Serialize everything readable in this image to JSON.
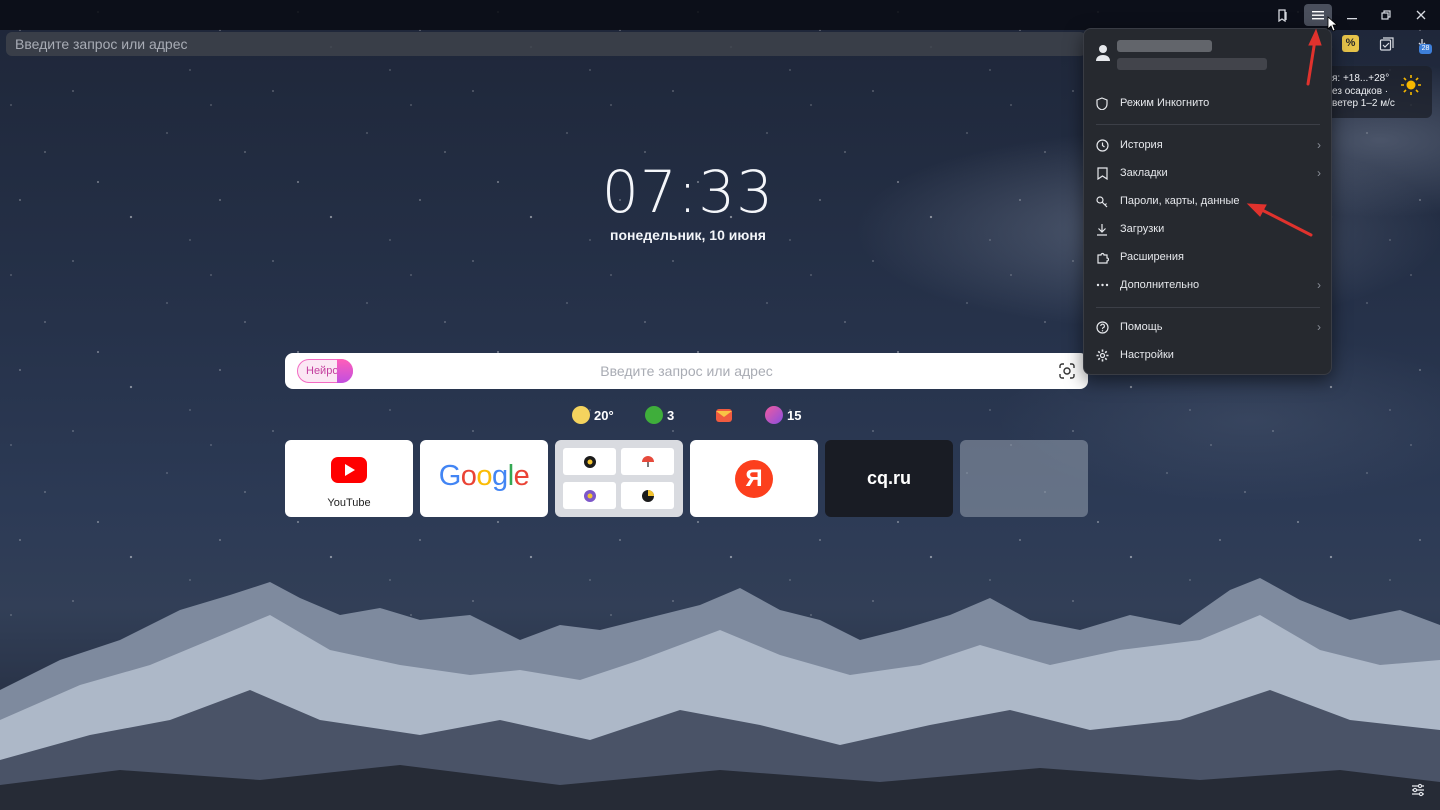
{
  "address_bar": {
    "placeholder": "Введите запрос или адрес"
  },
  "weather_widget": {
    "line1": "я: +18...+28°",
    "line2": "ез осадков ·",
    "line3": "ветер 1–2 м/с",
    "icon": "sun-icon"
  },
  "clock": {
    "time": "07:33",
    "date": "понедельник, 10 июня"
  },
  "search": {
    "mode_label": "Нейро",
    "placeholder": "Введите запрос или адрес"
  },
  "informers": [
    {
      "icon": "weather-sun-icon",
      "value": "20°",
      "color": "#f4d35e"
    },
    {
      "icon": "traffic-icon",
      "value": "3",
      "color": "#3fae3b"
    },
    {
      "icon": "mail-icon",
      "value": "",
      "color": "#f05b3f"
    },
    {
      "icon": "zen-icon",
      "value": "15",
      "color": "#d94fa8"
    }
  ],
  "tiles": [
    {
      "name": "youtube",
      "label": "YouTube"
    },
    {
      "name": "google",
      "label": "Google"
    },
    {
      "name": "group",
      "label": ""
    },
    {
      "name": "yandex",
      "label": "Я"
    },
    {
      "name": "cq",
      "label": "cq.ru"
    },
    {
      "name": "empty",
      "label": ""
    }
  ],
  "menu": {
    "items": [
      {
        "id": "incognito",
        "label": "Режим Инкогнито",
        "icon": "shield-icon",
        "submenu": false
      },
      {
        "id": "history",
        "label": "История",
        "icon": "clock-icon",
        "submenu": true
      },
      {
        "id": "bookmarks",
        "label": "Закладки",
        "icon": "bookmark-icon",
        "submenu": true
      },
      {
        "id": "passwords",
        "label": "Пароли, карты, данные",
        "icon": "key-icon",
        "submenu": false
      },
      {
        "id": "downloads",
        "label": "Загрузки",
        "icon": "download-icon",
        "submenu": false
      },
      {
        "id": "extensions",
        "label": "Расширения",
        "icon": "puzzle-icon",
        "submenu": false
      },
      {
        "id": "more",
        "label": "Дополнительно",
        "icon": "ellipsis-icon",
        "submenu": true
      },
      {
        "id": "help",
        "label": "Помощь",
        "icon": "help-icon",
        "submenu": true
      },
      {
        "id": "settings",
        "label": "Настройки",
        "icon": "gear-icon",
        "submenu": false
      }
    ]
  },
  "colors": {
    "menu_bg": "#26292f",
    "annotation_red": "#e0322d",
    "youtube_red": "#ff0000",
    "yandex_red": "#fc3f1d"
  }
}
